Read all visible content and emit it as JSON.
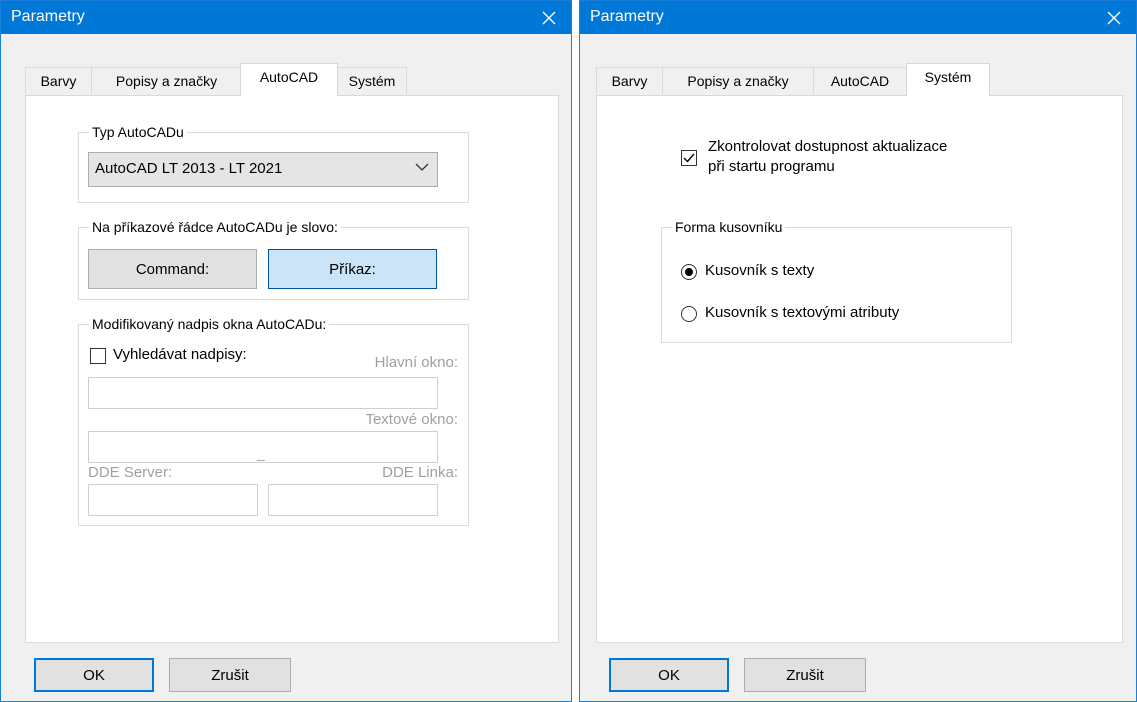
{
  "dialog1": {
    "title": "Parametry",
    "tabs": [
      "Barvy",
      "Popisy a značky",
      "AutoCAD",
      "Systém"
    ],
    "active_tab": "AutoCAD",
    "typ_group": {
      "legend": "Typ AutoCADu",
      "selected": "AutoCAD LT 2013 - LT 2021"
    },
    "command_group": {
      "legend": "Na příkazové řádce AutoCADu je slovo:",
      "command_label": "Command:",
      "prikaz_label": "Příkaz:",
      "pressed": "Příkaz:"
    },
    "caption_group": {
      "legend": "Modifikovaný nadpis okna AutoCADu:",
      "search_label": "Vyhledávat nadpisy:",
      "search_checked": false,
      "hlavni_label": "Hlavní okno:",
      "hlavni_value": "",
      "textove_label": "Textové okno:",
      "textove_value": "",
      "dde_server_label": "DDE Server:",
      "dde_server_value": "",
      "separator": "_",
      "dde_linka_label": "DDE Linka:",
      "dde_linka_value": ""
    },
    "ok_label": "OK",
    "cancel_label": "Zrušit"
  },
  "dialog2": {
    "title": "Parametry",
    "tabs": [
      "Barvy",
      "Popisy a značky",
      "AutoCAD",
      "Systém"
    ],
    "active_tab": "Systém",
    "update_check": {
      "line1": "Zkontrolovat dostupnost aktualizace",
      "line2": "při startu programu",
      "checked": true
    },
    "bom_group": {
      "legend": "Forma kusovníku",
      "options": [
        "Kusovník s texty",
        "Kusovník s textovými atributy"
      ],
      "selected_index": 0
    },
    "ok_label": "OK",
    "cancel_label": "Zrušit"
  },
  "colors": {
    "accent": "#0078d7",
    "dialog_bg": "#f0f0f0",
    "disabled_text": "#a0a0a0"
  },
  "icons": {
    "close": "close-icon",
    "dropdown": "chevron-down-icon",
    "check": "checkmark-icon"
  }
}
